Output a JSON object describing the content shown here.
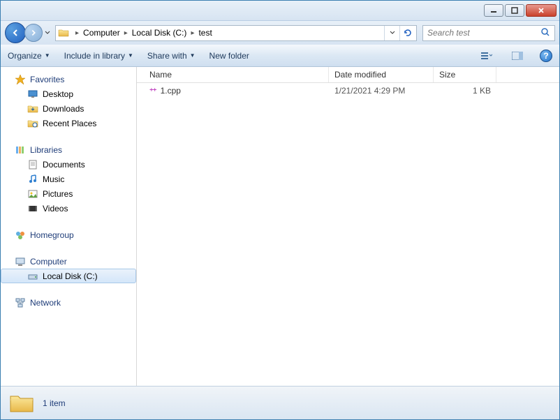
{
  "breadcrumb": {
    "crumb0": "Computer",
    "crumb1": "Local Disk (C:)",
    "crumb2": "test"
  },
  "search": {
    "placeholder": "Search test"
  },
  "toolbar": {
    "organize": "Organize",
    "include": "Include in library",
    "share": "Share with",
    "newfolder": "New folder"
  },
  "columns": {
    "name": "Name",
    "date": "Date modified",
    "size": "Size"
  },
  "nav": {
    "favorites": "Favorites",
    "desktop": "Desktop",
    "downloads": "Downloads",
    "recent": "Recent Places",
    "libraries": "Libraries",
    "documents": "Documents",
    "music": "Music",
    "pictures": "Pictures",
    "videos": "Videos",
    "homegroup": "Homegroup",
    "computer": "Computer",
    "localdisk": "Local Disk (C:)",
    "network": "Network"
  },
  "files": [
    {
      "name": "1.cpp",
      "date": "1/21/2021 4:29 PM",
      "size": "1 KB"
    }
  ],
  "status": {
    "count": "1 item"
  }
}
